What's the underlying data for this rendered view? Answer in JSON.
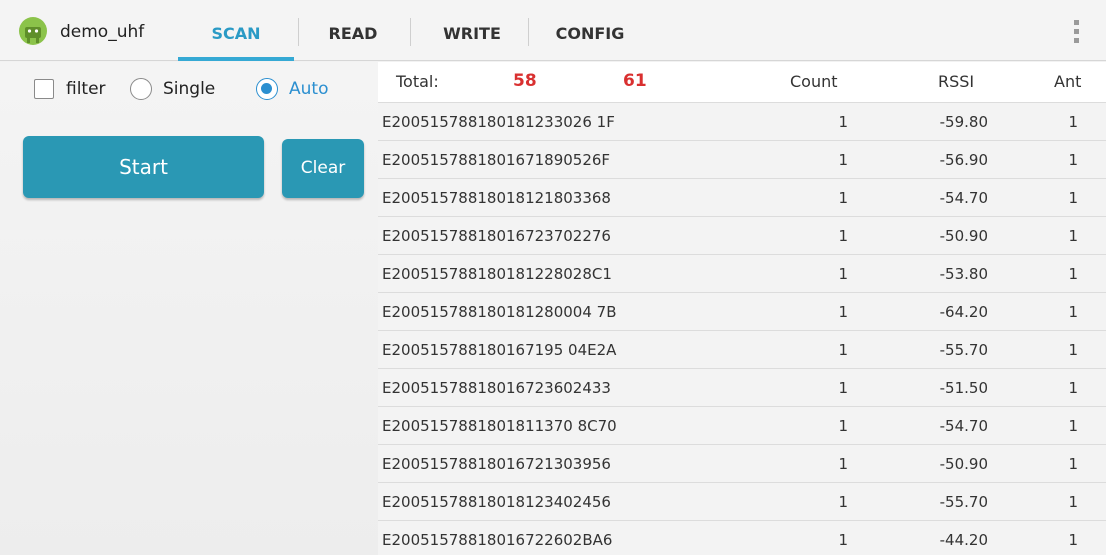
{
  "app": {
    "title": "demo_uhf"
  },
  "tabs": [
    {
      "label": "SCAN"
    },
    {
      "label": "READ"
    },
    {
      "label": "WRITE"
    },
    {
      "label": "CONFIG"
    }
  ],
  "controls": {
    "filter_label": "filter",
    "single_label": "Single",
    "auto_label": "Auto",
    "mode_selected": "Auto",
    "start_label": "Start",
    "clear_label": "Clear"
  },
  "table": {
    "total_label": "Total:",
    "total_value_1": "58",
    "total_value_2": "61",
    "col_count": "Count",
    "col_rssi": "RSSI",
    "col_ant": "Ant",
    "rows": [
      {
        "epc": "E200515788180181233026 1F",
        "count": "1",
        "rssi": "-59.80",
        "ant": "1"
      },
      {
        "epc": "E2005157881801671890526F",
        "count": "1",
        "rssi": "-56.90",
        "ant": "1"
      },
      {
        "epc": "E20051578818018121803368",
        "count": "1",
        "rssi": "-54.70",
        "ant": "1"
      },
      {
        "epc": "E20051578818016723702276",
        "count": "1",
        "rssi": "-50.90",
        "ant": "1"
      },
      {
        "epc": "E200515788180181228028C1",
        "count": "1",
        "rssi": "-53.80",
        "ant": "1"
      },
      {
        "epc": "E200515788180181280004 7B",
        "count": "1",
        "rssi": "-64.20",
        "ant": "1"
      },
      {
        "epc": "E200515788180167195 04E2A",
        "count": "1",
        "rssi": "-55.70",
        "ant": "1"
      },
      {
        "epc": "E20051578818016723602433",
        "count": "1",
        "rssi": "-51.50",
        "ant": "1"
      },
      {
        "epc": "E2005157881801811370 8C70",
        "count": "1",
        "rssi": "-54.70",
        "ant": "1"
      },
      {
        "epc": "E20051578818016721303956",
        "count": "1",
        "rssi": "-50.90",
        "ant": "1"
      },
      {
        "epc": "E20051578818018123402456",
        "count": "1",
        "rssi": "-55.70",
        "ant": "1"
      },
      {
        "epc": "E20051578818016722602BA6",
        "count": "1",
        "rssi": "-44.20",
        "ant": "1"
      }
    ]
  }
}
